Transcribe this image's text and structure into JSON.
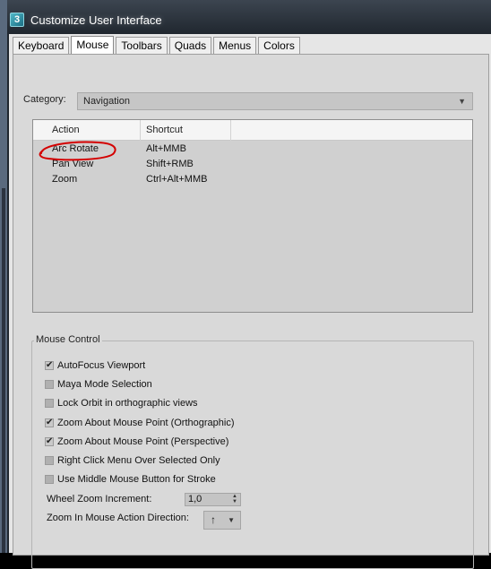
{
  "window": {
    "title": "Customize User Interface",
    "app_icon_glyph": "3"
  },
  "tabs": [
    "Keyboard",
    "Mouse",
    "Toolbars",
    "Quads",
    "Menus",
    "Colors"
  ],
  "active_tab": "Mouse",
  "category": {
    "label": "Category:",
    "value": "Navigation"
  },
  "table": {
    "headers": [
      "Action",
      "Shortcut"
    ],
    "rows": [
      {
        "action": "Arc Rotate",
        "shortcut": "Alt+MMB"
      },
      {
        "action": "Pan View",
        "shortcut": "Shift+RMB"
      },
      {
        "action": "Zoom",
        "shortcut": "Ctrl+Alt+MMB"
      }
    ]
  },
  "mouse_control": {
    "title": "Mouse Control",
    "options": [
      {
        "label": "AutoFocus Viewport",
        "checked": true
      },
      {
        "label": "Maya Mode Selection",
        "checked": false
      },
      {
        "label": "Lock Orbit in orthographic views",
        "checked": false
      },
      {
        "label": "Zoom About Mouse Point (Orthographic)",
        "checked": true
      },
      {
        "label": "Zoom About Mouse Point (Perspective)",
        "checked": true
      },
      {
        "label": "Right Click Menu Over Selected Only",
        "checked": false
      },
      {
        "label": "Use Middle Mouse Button for Stroke",
        "checked": false
      }
    ],
    "wheel_zoom_increment": {
      "label": "Wheel Zoom Increment:",
      "value": "1,0"
    },
    "zoom_direction": {
      "label": "Zoom In Mouse Action Direction:",
      "value": "↑"
    }
  },
  "colors": {
    "annotation": "#d40000",
    "accent": "#2a8aa0"
  }
}
